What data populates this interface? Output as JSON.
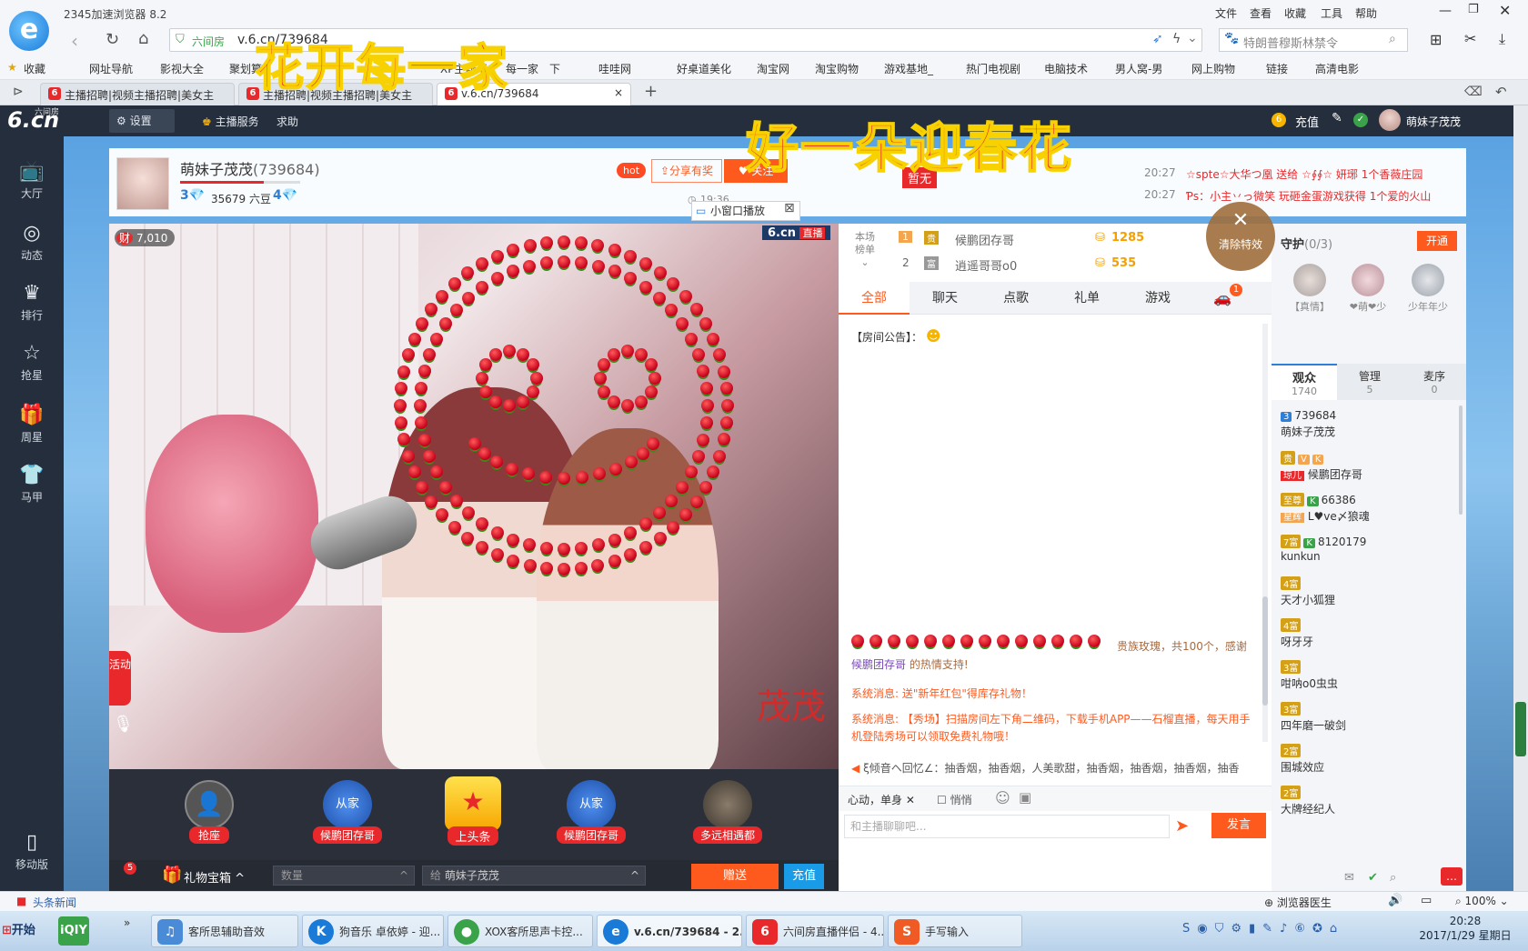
{
  "browser": {
    "title": "2345加速浏览器 8.2",
    "menu": [
      "文件",
      "查看",
      "收藏",
      "工具",
      "帮助"
    ],
    "address_badge": "六间房",
    "address_url": "v.6.cn/739684",
    "search_placeholder": "特朗普穆斯林禁令",
    "favorites_label": "收藏",
    "favorites": [
      "网址导航",
      "影视大全",
      "聚划算",
      "每一家",
      "XP主题下",
      "下",
      "哇哇网",
      "好桌道美化",
      "淘宝网",
      "淘宝购物",
      "游戏基地_",
      "热门电视剧",
      "电脑技术",
      "男人窝-男",
      "网上购物",
      "链接",
      "高清电影"
    ],
    "tabs": [
      "主播招聘|视频主播招聘|美女主",
      "主播招聘|视频主播招聘|美女主",
      "v.6.cn/739684"
    ]
  },
  "site": {
    "logo_text": "6.cn",
    "logo_sub": "六间房",
    "settings_label": "设置",
    "anchor_service": "主播服务",
    "help": "求助",
    "recharge": "充值",
    "username": "萌妹子茂茂",
    "left_nav": [
      "大厅",
      "动态",
      "排行",
      "抢星",
      "周星",
      "马甲",
      "移动版"
    ],
    "left_nav_icons": [
      "tv-icon",
      "compass-icon",
      "crown-icon",
      "star-icon",
      "gift-icon",
      "shirt-icon",
      "mobile-icon"
    ]
  },
  "overlay": {
    "text1": "花开每一家",
    "text2": "好一朵迎春花",
    "tag": "暂无"
  },
  "anchor": {
    "name": "萌妹子茂茂",
    "room_id": "(739684)",
    "level_left": "3",
    "six_beans": "35679 六豆",
    "level_right": "4",
    "hot": "hot",
    "share": "分享有奖",
    "follow": "关注",
    "time": "19:36",
    "mini_play": "小窗口播放",
    "fortune": "7,010"
  },
  "gift_feed": [
    {
      "time": "20:27",
      "text": "☆spte☆大华つ凰 送给 ☆∮∮☆ 妍琊 1个香薇庄园"
    },
    {
      "time": "20:27",
      "text": "Ƥs：小主丷っ微笑 玩砸金蛋游戏获得 1个爱的火山"
    }
  ],
  "clear_effects": "清除特效",
  "video": {
    "badge_brand": "6.cn",
    "badge_live": "直播",
    "watermark_name": "茂茂",
    "activity_tab": "活动"
  },
  "gift_strip": {
    "items": [
      "抢座",
      "候鹏团存哥",
      "上头条",
      "候鹏团存哥",
      "多远相遇都"
    ],
    "treasure": "礼物宝箱",
    "qty_placeholder": "数量",
    "to_label": "给",
    "to_name": "萌妹子茂茂",
    "send": "赠送",
    "recharge": "充值",
    "badge_count": "5"
  },
  "rank": {
    "label": "本场榜单",
    "rows": [
      {
        "rank": "1",
        "name": "候鹏团存哥",
        "score": "1285"
      },
      {
        "rank": "2",
        "name": "逍遥哥哥o0",
        "score": "535"
      }
    ]
  },
  "chat_tabs": [
    "全部",
    "聊天",
    "点歌",
    "礼单",
    "游戏"
  ],
  "chat_car_badge": "1",
  "chat": {
    "announcement": "【房间公告】：",
    "gift_line": "贵族玫瑰，共100个，感谢",
    "gift_thanks_user": "候鹏团存哥",
    "gift_thanks_tail": " 的热情支持!",
    "sys1": "系统消息: 送\"新年红包\"得库存礼物！",
    "sys2": "系统消息: 【秀场】扫描房间左下角二维码，下载手机APP——石榴直播，每天用手机登陆秀场可以领取免费礼物哦！",
    "marquee": "ξ倾音ヘ回忆∠：抽香烟，抽香烟，人美歌甜，抽香烟，抽香烟，抽香烟，抽香",
    "mode": "心动，单身",
    "whisper": "悄悄",
    "input_placeholder": "和主播聊聊吧...",
    "send": "发言"
  },
  "guard": {
    "title": "守护",
    "count": "(0/3)",
    "open": "开通",
    "members": [
      "【真情】",
      "❤萌❤少",
      "少年年少"
    ]
  },
  "audience_tabs": [
    {
      "label": "观众",
      "count": "1740"
    },
    {
      "label": "管理",
      "count": "5"
    },
    {
      "label": "麦序",
      "count": "0"
    }
  ],
  "audience": [
    {
      "badge": "3",
      "name": "739684",
      "sub": "萌妹子茂茂"
    },
    {
      "badge": "贵",
      "name": "",
      "sub": "候鹏团存哥",
      "tag": "琼儿"
    },
    {
      "badge": "至尊",
      "name": "66386",
      "sub": "L♥ve〆狼魂",
      "tag": "星辉"
    },
    {
      "badge": "7富",
      "name": "8120179",
      "sub": "kunkun"
    },
    {
      "badge": "4富",
      "name": "",
      "sub": "天才小狐狸"
    },
    {
      "badge": "4富",
      "name": "",
      "sub": "呀牙牙"
    },
    {
      "badge": "3富",
      "name": "",
      "sub": "咁呐o0虫虫"
    },
    {
      "badge": "3富",
      "name": "",
      "sub": "四年磨一破剑"
    },
    {
      "badge": "2富",
      "name": "",
      "sub": "围城效应"
    },
    {
      "badge": "2富",
      "name": "",
      "sub": "大牌经纪人"
    }
  ],
  "status_bar": {
    "news": "头条新闻",
    "doctor": "浏览器医生",
    "zoom": "100%"
  },
  "taskbar": {
    "start": "开始",
    "items": [
      "客所思辅助音效",
      "狗音乐 卓依婷 - 迎...",
      "XOX客所思声卡控...",
      "v.6.cn/739684 - 2...",
      "六间房直播伴侣 - 4...",
      "手写输入"
    ],
    "time": "20:28",
    "date": "2017/1/29 星期日"
  },
  "colors": {
    "accent": "#ff5a1e",
    "site_dark": "#252e3c",
    "brand_red": "#e8282b"
  }
}
